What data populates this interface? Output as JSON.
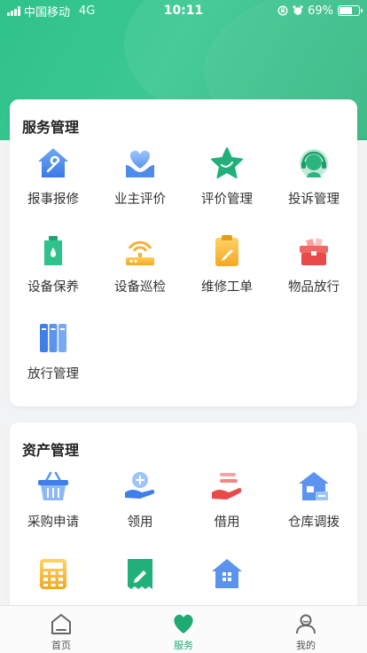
{
  "status_bar": {
    "carrier": "中国移动",
    "network": "4G",
    "time": "10:11",
    "battery": "69%",
    "battery_level": 0.69
  },
  "service_card": {
    "title": "服务管理",
    "items": [
      {
        "label": "报事报修",
        "icon": "house-wrench-icon"
      },
      {
        "label": "业主评价",
        "icon": "heart-hand-icon"
      },
      {
        "label": "评价管理",
        "icon": "star-icon"
      },
      {
        "label": "投诉管理",
        "icon": "headset-agent-icon"
      },
      {
        "label": "设备保养",
        "icon": "oil-can-icon"
      },
      {
        "label": "设备巡检",
        "icon": "router-icon"
      },
      {
        "label": "维修工单",
        "icon": "clipboard-pencil-icon"
      },
      {
        "label": "物品放行",
        "icon": "toolbox-icon"
      },
      {
        "label": "放行管理",
        "icon": "binders-icon"
      }
    ]
  },
  "asset_card": {
    "title": "资产管理",
    "items": [
      {
        "label": "采购申请",
        "icon": "basket-icon"
      },
      {
        "label": "领用",
        "icon": "hand-plus-icon"
      },
      {
        "label": "借用",
        "icon": "hand-give-icon"
      },
      {
        "label": "仓库调拨",
        "icon": "warehouse-icon"
      },
      {
        "label": "",
        "icon": "calculator-icon"
      },
      {
        "label": "",
        "icon": "receipt-pencil-icon"
      },
      {
        "label": "",
        "icon": "house-grid-icon"
      }
    ]
  },
  "tabbar": {
    "tabs": [
      {
        "label": "首页",
        "icon": "home-icon",
        "active": false
      },
      {
        "label": "服务",
        "icon": "heart-icon",
        "active": true
      },
      {
        "label": "我的",
        "icon": "user-icon",
        "active": false
      }
    ]
  },
  "colors": {
    "brand_green": "#2fc28a",
    "active_tab": "#1faa74"
  }
}
